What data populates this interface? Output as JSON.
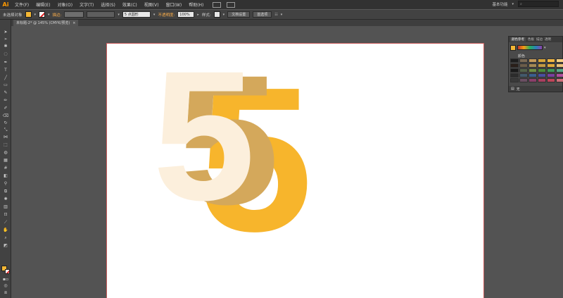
{
  "app": {
    "logo": "Ai"
  },
  "menu": [
    "文件(F)",
    "编辑(E)",
    "对象(O)",
    "文字(T)",
    "选择(S)",
    "效果(C)",
    "视图(V)",
    "窗口(W)",
    "帮助(H)"
  ],
  "workspace": "基本功能",
  "control": {
    "selection_label": "未选择对象",
    "stroke_label": "描边:",
    "brush_value": "5 点圆形",
    "opacity_label": "不透明度:",
    "opacity_value": "100%",
    "style_label": "样式:",
    "doc_setup_btn": "文档设置",
    "prefs_btn": "首选项"
  },
  "doc_tab": {
    "title": "未标题-2* @ 145% (CMYK/预览)",
    "close": "×"
  },
  "canvas": {
    "glyph": "5",
    "colors": [
      "#f7b52c",
      "#d4a85b",
      "#fcefdc"
    ]
  },
  "swatches_panel": {
    "tabs": [
      "颜色参考",
      "色板",
      "描边",
      "透明"
    ],
    "group_label": "颜色",
    "footer_label": "无",
    "colors": [
      "#1e1e1e",
      "#7b6a55",
      "#c59b5a",
      "#d8a53a",
      "#f2b642",
      "#f6cf82",
      "#2a1f1a",
      "#6b5d4a",
      "#a58a55",
      "#c39a44",
      "#e0a93b",
      "#eac17a",
      "#1a1a1a",
      "#54634a",
      "#6f8f45",
      "#4d8c3a",
      "#3e9a5a",
      "#58a88a",
      "#2c2c2c",
      "#435a6b",
      "#3b5f8f",
      "#4a4fa0",
      "#7a3fa0",
      "#b14f9f",
      "#3a3a3a",
      "#6a4f62",
      "#8a3f6a",
      "#a83f5f",
      "#c0465a",
      "#d0707a"
    ]
  }
}
